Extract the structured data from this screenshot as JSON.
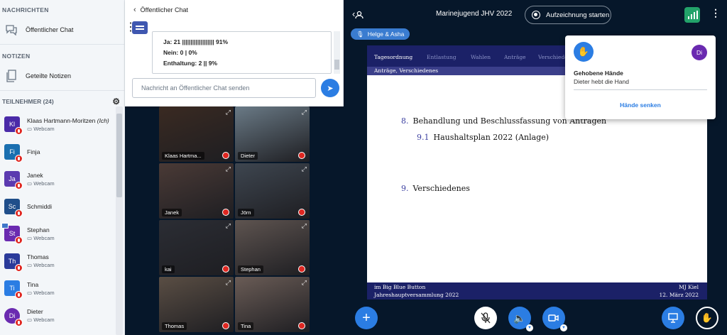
{
  "sidebar": {
    "messages_title": "NACHRICHTEN",
    "public_chat": "Öffentlicher Chat",
    "notes_title": "NOTIZEN",
    "shared_notes": "Geteilte Notizen",
    "participants_title": "TEILNEHMER (24)",
    "participants": [
      {
        "initials": "Kl",
        "name": "Klaas Hartmann-Moritzen",
        "suffix": "(Ich)",
        "sub": "Webcam",
        "color": "#4a2aa8"
      },
      {
        "initials": "Fi",
        "name": "Finja",
        "suffix": "",
        "sub": "",
        "color": "#1a6fb0"
      },
      {
        "initials": "Ja",
        "name": "Janek",
        "suffix": "",
        "sub": "Webcam",
        "color": "#5b3ab0"
      },
      {
        "initials": "Sc",
        "name": "Schmiddi",
        "suffix": "",
        "sub": "",
        "color": "#1f4e8a"
      },
      {
        "initials": "St",
        "name": "Stephan",
        "suffix": "",
        "sub": "Webcam",
        "color": "#6a2ab0"
      },
      {
        "initials": "Th",
        "name": "Thomas",
        "suffix": "",
        "sub": "Webcam",
        "color": "#2a3a9a"
      },
      {
        "initials": "Ti",
        "name": "Tina",
        "suffix": "",
        "sub": "Webcam",
        "color": "#2b7de3"
      },
      {
        "initials": "Di",
        "name": "Dieter",
        "suffix": "",
        "sub": "Webcam",
        "color": "#6a2ab0"
      }
    ]
  },
  "chat": {
    "title": "Öffentlicher Chat",
    "poll_lines": [
      "Ja: 21 ||||||||||||||||||| 91%",
      "Nein: 0 | 0%",
      "Enthaltung: 2 || 9%"
    ],
    "input_placeholder": "Nachricht an Öffentlicher Chat senden"
  },
  "videos": [
    {
      "name": "Klaas Hartma...",
      "bg": "#3a2a22"
    },
    {
      "name": "Dieter",
      "bg": "#6a7a86"
    },
    {
      "name": "Janek",
      "bg": "#4a3a36"
    },
    {
      "name": "Jörn",
      "bg": "#3e4650"
    },
    {
      "name": "kai",
      "bg": "#2b2d34"
    },
    {
      "name": "Stephan",
      "bg": "#5e5450"
    },
    {
      "name": "Thomas",
      "bg": "#5a4e44"
    },
    {
      "name": "Tina",
      "bg": "#6a5c56"
    }
  ],
  "topbar": {
    "meeting_title": "Marinejugend JHV 2022",
    "record_label": "Aufzeichnung starten"
  },
  "talker": "Helge & Asha",
  "slide": {
    "nav": [
      "Tagesordnung",
      "Entlastung",
      "Wahlen",
      "Anträge",
      "Verschiedenes"
    ],
    "subheader": "Anträge, Verschiedenes",
    "items": [
      {
        "num": "8.",
        "text": "Behandlung und Beschlussfassung von Anträgen"
      },
      {
        "num": "9.1",
        "text": "Haushaltsplan 2022 (Anlage)"
      },
      {
        "num": "9.",
        "text": "Verschiedenes"
      }
    ],
    "footer_left_1": "im Big Blue Button",
    "footer_right_1": "MJ Kiel",
    "footer_left_2": "Jahreshauptversammlung 2022",
    "footer_right_2": "12. März 2022"
  },
  "hands": {
    "avatar": "Di",
    "title": "Gehobene Hände",
    "text": "Dieter hebt die Hand",
    "lower_label": "Hände senken"
  }
}
